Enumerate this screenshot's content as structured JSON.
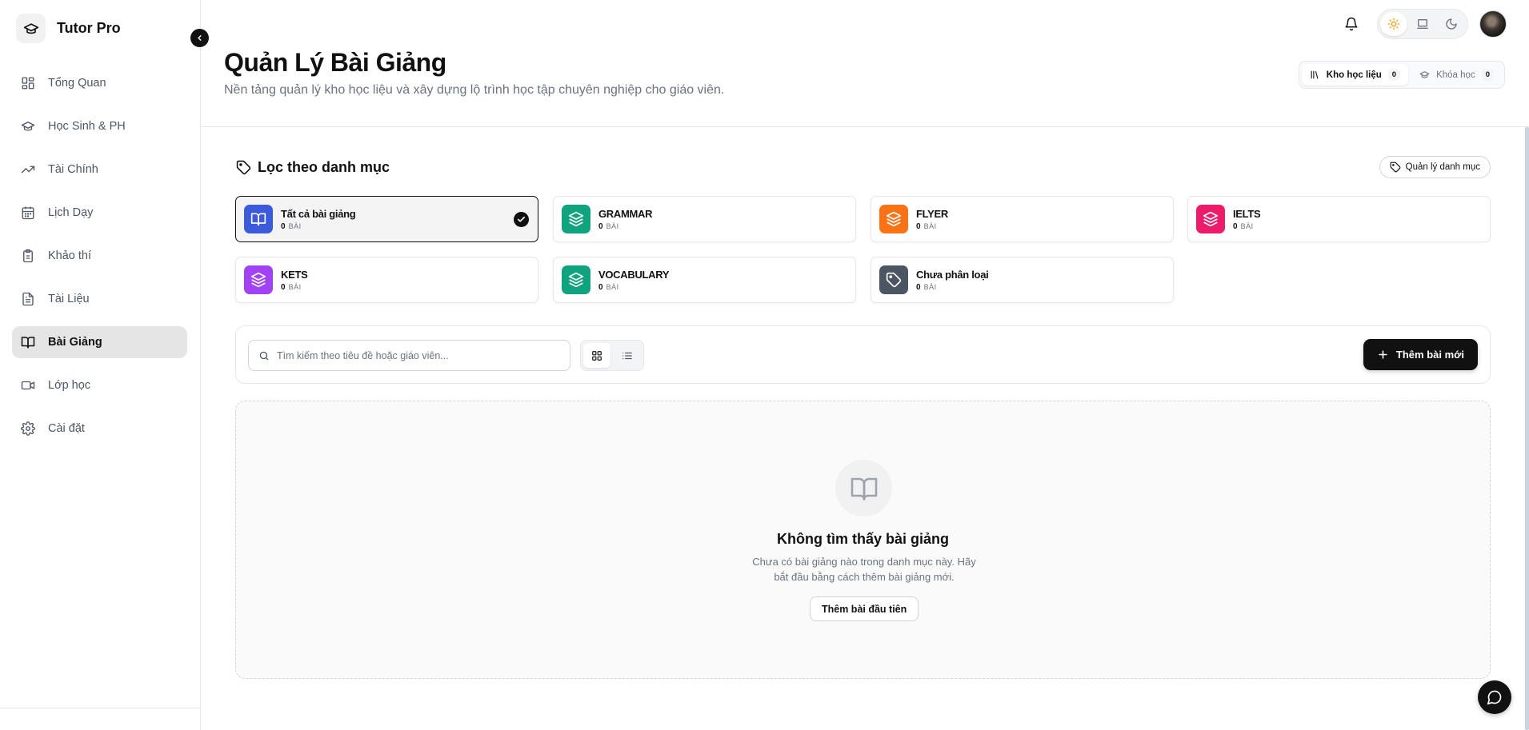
{
  "brand": {
    "name": "Tutor Pro"
  },
  "sidebar": {
    "items": [
      {
        "label": "Tổng Quan",
        "icon": "grid-icon"
      },
      {
        "label": "Học Sinh & PH",
        "icon": "graduation-cap-icon"
      },
      {
        "label": "Tài Chính",
        "icon": "trending-up-icon"
      },
      {
        "label": "Lịch Dạy",
        "icon": "calendar-icon"
      },
      {
        "label": "Khảo thí",
        "icon": "clipboard-icon"
      },
      {
        "label": "Tài Liệu",
        "icon": "file-text-icon"
      },
      {
        "label": "Bài Giảng",
        "icon": "book-open-icon",
        "active": true
      },
      {
        "label": "Lớp học",
        "icon": "video-icon"
      },
      {
        "label": "Cài đặt",
        "icon": "gear-icon"
      }
    ]
  },
  "header": {
    "title": "Quản Lý Bài Giảng",
    "subtitle": "Nền tảng quản lý kho học liệu và xây dựng lộ trình học tập chuyên nghiệp cho giáo viên.",
    "tabs": [
      {
        "label": "Kho học liệu",
        "count": "0",
        "active": true
      },
      {
        "label": "Khóa học",
        "count": "0",
        "active": false
      }
    ]
  },
  "filter": {
    "title": "Lọc theo danh mục",
    "manage_label": "Quản lý danh mục",
    "unit": "BÀI",
    "categories": [
      {
        "name": "Tất cả bài giảng",
        "count": "0",
        "color": "#3b5bdb",
        "icon": "book-open-icon",
        "selected": true
      },
      {
        "name": "GRAMMAR",
        "count": "0",
        "color": "#10a37f",
        "icon": "layers-icon"
      },
      {
        "name": "FLYER",
        "count": "0",
        "color": "#f97316",
        "icon": "layers-icon"
      },
      {
        "name": "IELTS",
        "count": "0",
        "color": "#ec1c6b",
        "icon": "layers-icon"
      },
      {
        "name": "KETS",
        "count": "0",
        "color": "#a142f4",
        "icon": "layers-icon"
      },
      {
        "name": "VOCABULARY",
        "count": "0",
        "color": "#10a37f",
        "icon": "layers-icon"
      },
      {
        "name": "Chưa phân loại",
        "count": "0",
        "color": "#4b5563",
        "icon": "tag-icon"
      }
    ]
  },
  "toolbar": {
    "search_placeholder": "Tìm kiếm theo tiêu đề hoặc giáo viên...",
    "add_label": "Thêm bài mới"
  },
  "empty": {
    "title": "Không tìm thấy bài giảng",
    "description": "Chưa có bài giảng nào trong danh mục này. Hãy bắt đầu bằng cách thêm bài giảng mới.",
    "button_label": "Thêm bài đầu tiên"
  }
}
